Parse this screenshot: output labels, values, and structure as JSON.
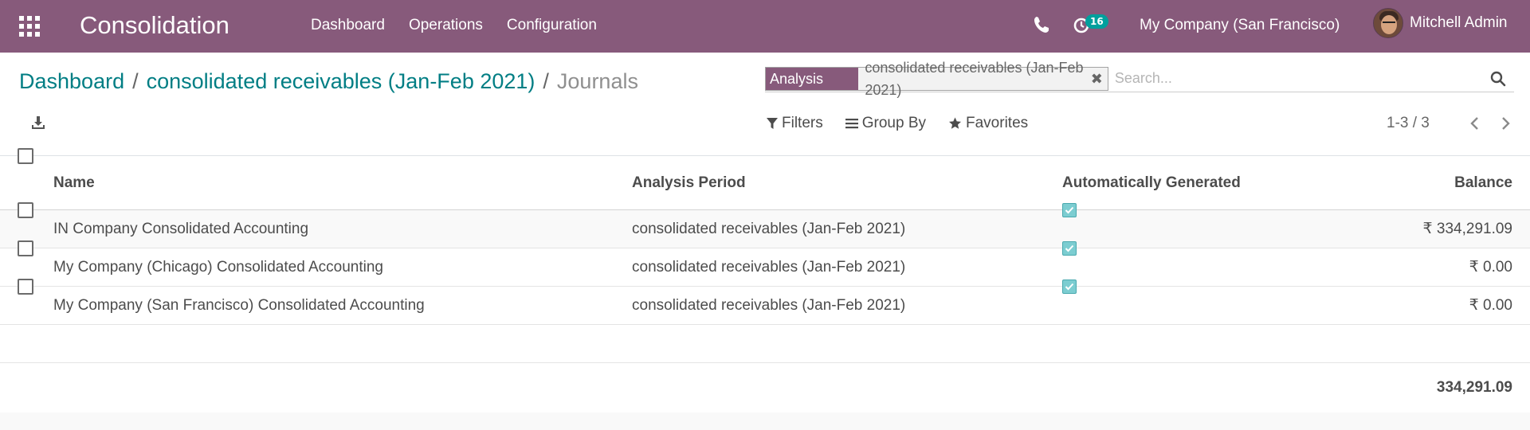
{
  "navbar": {
    "app_title": "Consolidation",
    "menu": [
      "Dashboard",
      "Operations",
      "Configuration"
    ],
    "activity_count": "16",
    "company": "My Company (San Francisco)",
    "user_name": "Mitchell Admin",
    "bg_color": "#875a7b"
  },
  "breadcrumb": {
    "items": [
      "Dashboard",
      "consolidated receivables (Jan-Feb 2021)"
    ],
    "separator": "/",
    "current": "Journals"
  },
  "search": {
    "facet_label": "Analysis Period",
    "facet_value": "consolidated receivables (Jan-Feb 2021)",
    "placeholder": "Search..."
  },
  "toolbar": {
    "filters_label": "Filters",
    "group_by_label": "Group By",
    "favorites_label": "Favorites"
  },
  "pager": {
    "value": "1-3 / 3"
  },
  "table": {
    "columns": {
      "name": "Name",
      "period": "Analysis Period",
      "auto": "Automatically Generated",
      "balance": "Balance"
    },
    "rows": [
      {
        "name": "IN Company Consolidated Accounting",
        "period": "consolidated receivables (Jan-Feb 2021)",
        "auto": true,
        "balance": "₹ 334,291.09"
      },
      {
        "name": "My Company (Chicago) Consolidated Accounting",
        "period": "consolidated receivables (Jan-Feb 2021)",
        "auto": true,
        "balance": "₹ 0.00"
      },
      {
        "name": "My Company (San Francisco) Consolidated Accounting",
        "period": "consolidated receivables (Jan-Feb 2021)",
        "auto": true,
        "balance": "₹ 0.00"
      }
    ],
    "total": "334,291.09"
  },
  "icons": {
    "apps": "apps-grid-icon",
    "phone": "phone-icon",
    "activity": "clock-icon",
    "download": "download-icon",
    "search": "search-icon",
    "filter": "filter-icon",
    "group_by": "bars-icon",
    "favorites": "star-icon",
    "pager_prev": "chevron-left-icon",
    "pager_next": "chevron-right-icon"
  },
  "colors": {
    "link": "#017e84",
    "checked": "#7ccdd1"
  }
}
